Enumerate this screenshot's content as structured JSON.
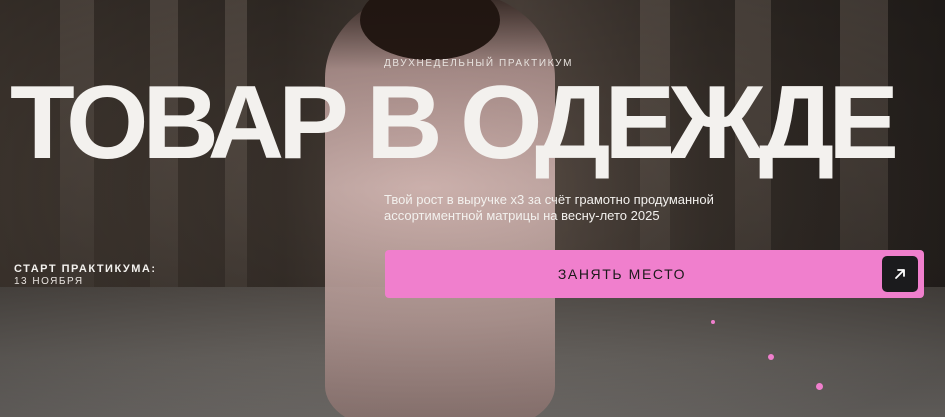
{
  "hero": {
    "eyebrow": "ДВУХНЕДЕЛЬНЫЙ ПРАКТИКУМ",
    "title": "ТОВАР В ОДЕЖДЕ",
    "subtitle": "Твой рост в выручке х3 за счёт грамотно продуманной ассортиментной матрицы на весну-лето 2025",
    "start_label": "СТАРТ ПРАКТИКУМА:",
    "start_date": "13 НОЯБРЯ",
    "cta_label": "ЗАНЯТЬ МЕСТО",
    "cta_icon": "arrow-up-right-icon"
  },
  "colors": {
    "accent": "#f07fcd",
    "text": "#f3f1ee",
    "icon_bg": "#1b1b1d"
  }
}
